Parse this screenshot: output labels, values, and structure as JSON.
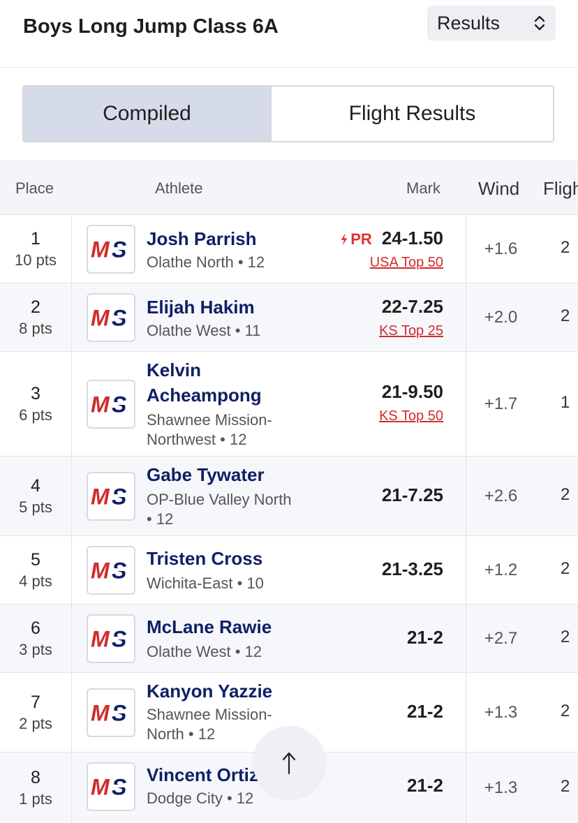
{
  "header": {
    "title": "Boys Long Jump Class 6A",
    "select_value": "Results"
  },
  "tabs": [
    {
      "label": "Compiled",
      "active": true
    },
    {
      "label": "Flight Results",
      "active": false
    }
  ],
  "table": {
    "headers": {
      "place": "Place",
      "athlete": "Athlete",
      "mark": "Mark",
      "wind": "Wind",
      "flight": "Fligh"
    },
    "rows": [
      {
        "place": "1",
        "pts": "10 pts",
        "name": "Josh Parrish",
        "name2": "",
        "school": "Olathe North • 12",
        "school2": "",
        "pr": "PR",
        "mark": "24-1.50",
        "badge": "USA Top 50",
        "wind": "+1.6",
        "flight": "2"
      },
      {
        "place": "2",
        "pts": "8 pts",
        "name": "Elijah Hakim",
        "name2": "",
        "school": "Olathe West • 11",
        "school2": "",
        "pr": "",
        "mark": "22-7.25",
        "badge": "KS Top 25",
        "wind": "+2.0",
        "flight": "2"
      },
      {
        "place": "3",
        "pts": "6 pts",
        "name": "Kelvin",
        "name2": "Acheampong",
        "school": "Shawnee Mission-",
        "school2": "Northwest • 12",
        "pr": "",
        "mark": "21-9.50",
        "badge": "KS Top 50",
        "wind": "+1.7",
        "flight": "1"
      },
      {
        "place": "4",
        "pts": "5 pts",
        "name": "Gabe Tywater",
        "name2": "",
        "school": "OP-Blue Valley North",
        "school2": "• 12",
        "pr": "",
        "mark": "21-7.25",
        "badge": "",
        "wind": "+2.6",
        "flight": "2"
      },
      {
        "place": "5",
        "pts": "4 pts",
        "name": "Tristen Cross",
        "name2": "",
        "school": "Wichita-East • 10",
        "school2": "",
        "pr": "",
        "mark": "21-3.25",
        "badge": "",
        "wind": "+1.2",
        "flight": "2"
      },
      {
        "place": "6",
        "pts": "3 pts",
        "name": "McLane Rawie",
        "name2": "",
        "school": "Olathe West • 12",
        "school2": "",
        "pr": "",
        "mark": "21-2",
        "badge": "",
        "wind": "+2.7",
        "flight": "2"
      },
      {
        "place": "7",
        "pts": "2 pts",
        "name": "Kanyon Yazzie",
        "name2": "",
        "school": "Shawnee Mission-",
        "school2": "North • 12",
        "pr": "",
        "mark": "21-2",
        "badge": "",
        "wind": "+1.3",
        "flight": "2"
      },
      {
        "place": "8",
        "pts": "1 pts",
        "name": "Vincent Ortiz",
        "name2": "",
        "school": "Dodge City • 12",
        "school2": "",
        "pr": "",
        "mark": "21-2",
        "badge": "",
        "wind": "+1.3",
        "flight": "2"
      }
    ]
  },
  "logo_text": "MS",
  "colors": {
    "brand_red": "#d12b2b",
    "brand_navy": "#0f1f66",
    "tab_active": "#d6dbe9"
  },
  "icons": {
    "select": "chevron-up-down-icon",
    "pr": "lightning-icon",
    "scroll": "arrow-up-icon"
  }
}
